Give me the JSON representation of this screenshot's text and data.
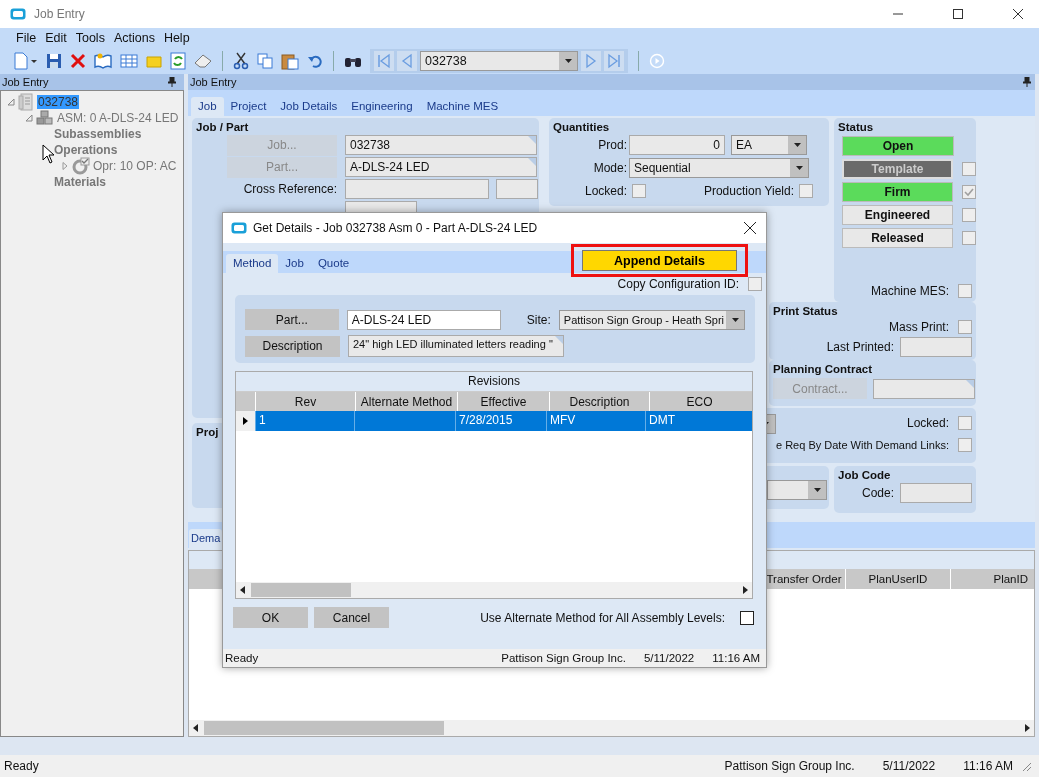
{
  "window": {
    "title": "Job Entry"
  },
  "menu": [
    "File",
    "Edit",
    "Tools",
    "Actions",
    "Help"
  ],
  "toolbar": {
    "record": "032738"
  },
  "tree_panel": {
    "title": "Job Entry",
    "tree": [
      {
        "label": "032738",
        "kind": "job",
        "selected": true,
        "expanded": true,
        "children": [
          {
            "label": "ASM: 0 A-DLS-24 LED",
            "kind": "assembly",
            "selected": false,
            "expanded": true,
            "children": [
              {
                "label": "Subassemblies",
                "kind": "folder",
                "selected": false
              },
              {
                "label": "Operations",
                "kind": "folder",
                "selected": false,
                "children": [
                  {
                    "label": "Opr: 10 OP: AC",
                    "kind": "operation",
                    "selected": false,
                    "expanded": false
                  }
                ]
              },
              {
                "label": "Materials",
                "kind": "folder",
                "selected": false
              }
            ]
          }
        ]
      }
    ]
  },
  "main": {
    "title": "Job Entry",
    "tabs": [
      {
        "label": "Job",
        "selected": true
      },
      {
        "label": "Project",
        "selected": false
      },
      {
        "label": "Job Details",
        "selected": false
      },
      {
        "label": "Engineering",
        "selected": false
      },
      {
        "label": "Machine MES",
        "selected": false
      }
    ],
    "job_part": {
      "title": "Job / Part",
      "job_button": "Job...",
      "job": "032738",
      "part_button": "Part...",
      "part": "A-DLS-24 LED",
      "cross_reference_label": "Cross Reference:"
    },
    "project_title": "Proj",
    "quantities": {
      "title": "Quantities",
      "prod_label": "Prod:",
      "prod": "0",
      "uom": "EA",
      "mode_label": "Mode:",
      "mode": "Sequential",
      "locked_label": "Locked:",
      "locked": false,
      "yield_label": "Production Yield:",
      "production_yield": false
    },
    "status": {
      "title": "Status",
      "buttons": [
        {
          "label": "Open",
          "on": true,
          "disabled": false
        },
        {
          "label": "Template",
          "on": false,
          "disabled": true,
          "checked": false
        },
        {
          "label": "Firm",
          "on": true,
          "disabled": false,
          "checked": true
        },
        {
          "label": "Engineered",
          "on": false,
          "disabled": false,
          "checked": false
        },
        {
          "label": "Released",
          "on": false,
          "disabled": false,
          "checked": false
        }
      ],
      "machine_mes_label": "Machine MES:",
      "machine_mes": false
    },
    "print_status": {
      "title": "Print Status",
      "mass_print_label": "Mass Print:",
      "mass_print": false,
      "last_printed_label": "Last Printed:"
    },
    "planning_contract": {
      "title": "Planning Contract",
      "contract_button": "Contract..."
    },
    "scheduling": {
      "locked_label": "Locked:",
      "locked": false,
      "demand_label": "e Req By Date With Demand Links:",
      "demand_links": false
    },
    "job_code": {
      "title": "Job Code",
      "code_label": "Code:"
    },
    "lower_tabs": [
      {
        "label": "Dema",
        "selected": true
      }
    ],
    "lower_grid": {
      "columns": [
        "Transfer Order",
        "PlanUserID",
        "PlanID"
      ]
    }
  },
  "status_bar": {
    "text": "Ready",
    "company": "Pattison Sign Group Inc.",
    "date": "5/11/2022",
    "time": "11:16 AM"
  },
  "dialog": {
    "title": "Get Details - Job 032738 Asm 0 - Part A-DLS-24 LED",
    "tabs": [
      {
        "label": "Method",
        "selected": true
      },
      {
        "label": "Job",
        "selected": false
      },
      {
        "label": "Quote",
        "selected": false
      }
    ],
    "append_button": "Append Details",
    "append_highlighted": true,
    "copy_config_label": "Copy Configuration ID:",
    "copy_config": false,
    "part_button": "Part...",
    "part": "A-DLS-24 LED",
    "site_label": "Site:",
    "site": "Pattison Sign Group - Heath Spri",
    "description_button": "Description",
    "description": "24\" high LED illuminated letters reading \"",
    "grid": {
      "title": "Revisions",
      "columns": [
        "Rev",
        "Alternate Method",
        "Effective",
        "Description",
        "ECO"
      ],
      "rows": [
        {
          "rev": "1",
          "effective": "7/28/2015",
          "description": "MFV",
          "eco": "DMT",
          "selected": true
        }
      ]
    },
    "ok": "OK",
    "cancel": "Cancel",
    "use_alt_label": "Use Alternate Method for All Assembly Levels:",
    "use_alt": false,
    "status_bar": {
      "text": "Ready",
      "company": "Pattison Sign Group Inc.",
      "date": "5/11/2022",
      "time": "11:16 AM"
    }
  }
}
